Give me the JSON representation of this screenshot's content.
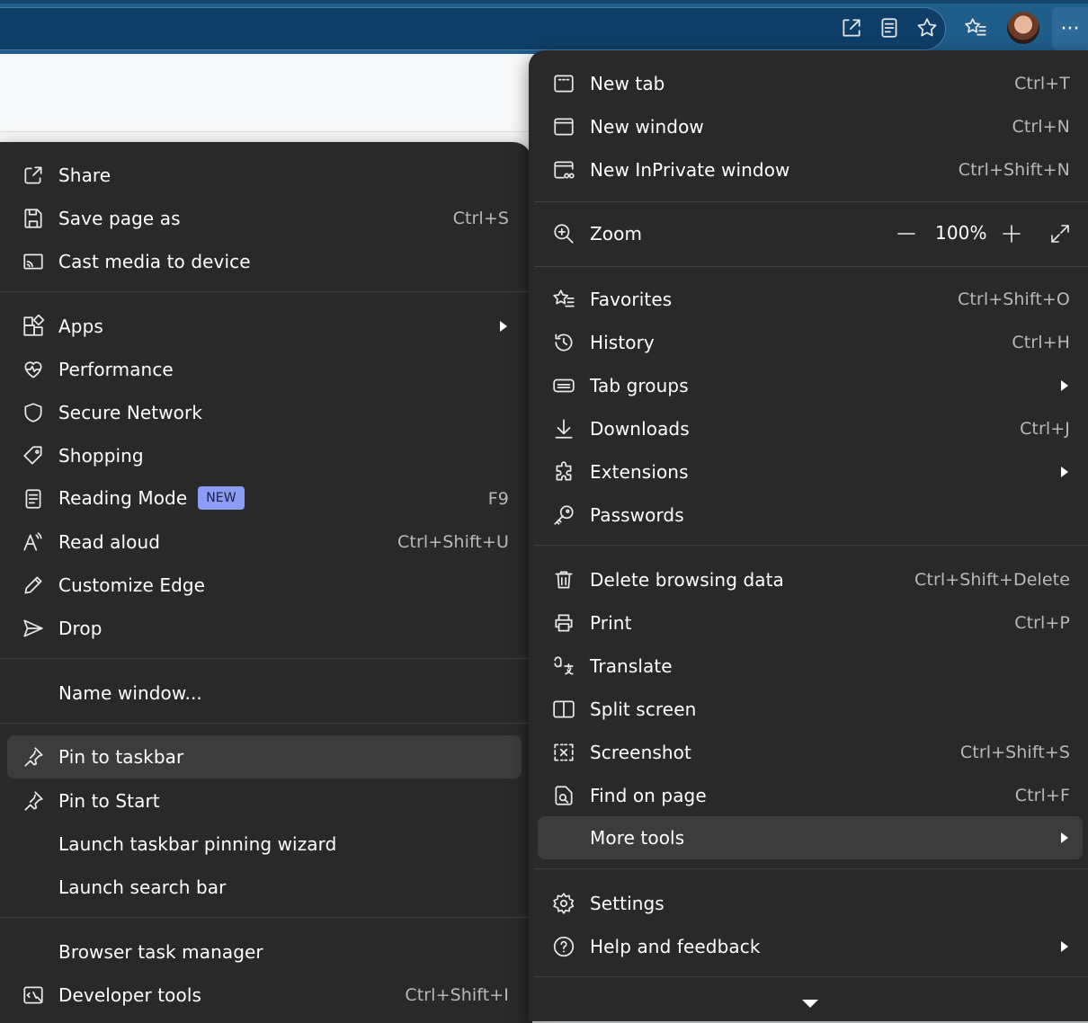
{
  "toolbar": {
    "icons": [
      "open-in-app-icon",
      "reading-view-icon",
      "favorite-star-icon",
      "favorites-icon",
      "profile-avatar",
      "more-icon"
    ],
    "more_label": "···"
  },
  "left_menu": {
    "items": [
      {
        "label": "Share",
        "icon": "share-icon",
        "shortcut": ""
      },
      {
        "label": "Save page as",
        "icon": "save-icon",
        "shortcut": "Ctrl+S"
      },
      {
        "label": "Cast media to device",
        "icon": "cast-icon",
        "shortcut": ""
      },
      {
        "label": "Apps",
        "icon": "apps-icon",
        "shortcut": ""
      },
      {
        "label": "Performance",
        "icon": "performance-icon",
        "shortcut": ""
      },
      {
        "label": "Secure Network",
        "icon": "shield-icon",
        "shortcut": ""
      },
      {
        "label": "Shopping",
        "icon": "tag-icon",
        "shortcut": ""
      },
      {
        "label": "Reading Mode",
        "icon": "reading-mode-icon",
        "shortcut": "F9",
        "badge": "NEW"
      },
      {
        "label": "Read aloud",
        "icon": "read-aloud-icon",
        "shortcut": "Ctrl+Shift+U"
      },
      {
        "label": "Customize Edge",
        "icon": "pencil-icon",
        "shortcut": ""
      },
      {
        "label": "Drop",
        "icon": "send-icon",
        "shortcut": ""
      },
      {
        "label": "Name window...",
        "icon": "",
        "shortcut": ""
      },
      {
        "label": "Pin to taskbar",
        "icon": "pin-icon",
        "shortcut": ""
      },
      {
        "label": "Pin to Start",
        "icon": "pin-icon",
        "shortcut": ""
      },
      {
        "label": "Launch taskbar pinning wizard",
        "icon": "",
        "shortcut": ""
      },
      {
        "label": "Launch search bar",
        "icon": "",
        "shortcut": ""
      },
      {
        "label": "Browser task manager",
        "icon": "",
        "shortcut": ""
      },
      {
        "label": "Developer tools",
        "icon": "developer-tools-icon",
        "shortcut": "Ctrl+Shift+I"
      }
    ]
  },
  "right_menu": {
    "items": [
      {
        "label": "New tab",
        "icon": "new-tab-icon",
        "shortcut": "Ctrl+T"
      },
      {
        "label": "New window",
        "icon": "new-window-icon",
        "shortcut": "Ctrl+N"
      },
      {
        "label": "New InPrivate window",
        "icon": "inprivate-icon",
        "shortcut": "Ctrl+Shift+N"
      },
      {
        "label": "Zoom",
        "icon": "zoom-icon",
        "shortcut": ""
      },
      {
        "label": "Favorites",
        "icon": "favorites-icon",
        "shortcut": "Ctrl+Shift+O"
      },
      {
        "label": "History",
        "icon": "history-icon",
        "shortcut": "Ctrl+H"
      },
      {
        "label": "Tab groups",
        "icon": "tab-groups-icon",
        "shortcut": ""
      },
      {
        "label": "Downloads",
        "icon": "download-icon",
        "shortcut": "Ctrl+J"
      },
      {
        "label": "Extensions",
        "icon": "extensions-icon",
        "shortcut": ""
      },
      {
        "label": "Passwords",
        "icon": "key-icon",
        "shortcut": ""
      },
      {
        "label": "Delete browsing data",
        "icon": "trash-icon",
        "shortcut": "Ctrl+Shift+Delete"
      },
      {
        "label": "Print",
        "icon": "print-icon",
        "shortcut": "Ctrl+P"
      },
      {
        "label": "Translate",
        "icon": "translate-icon",
        "shortcut": ""
      },
      {
        "label": "Split screen",
        "icon": "split-screen-icon",
        "shortcut": ""
      },
      {
        "label": "Screenshot",
        "icon": "screenshot-icon",
        "shortcut": "Ctrl+Shift+S"
      },
      {
        "label": "Find on page",
        "icon": "find-icon",
        "shortcut": "Ctrl+F"
      },
      {
        "label": "More tools",
        "icon": "",
        "shortcut": ""
      },
      {
        "label": "Settings",
        "icon": "gear-icon",
        "shortcut": ""
      },
      {
        "label": "Help and feedback",
        "icon": "help-icon",
        "shortcut": ""
      }
    ],
    "zoom": {
      "minus": "—",
      "value": "100%",
      "plus": "+"
    }
  }
}
